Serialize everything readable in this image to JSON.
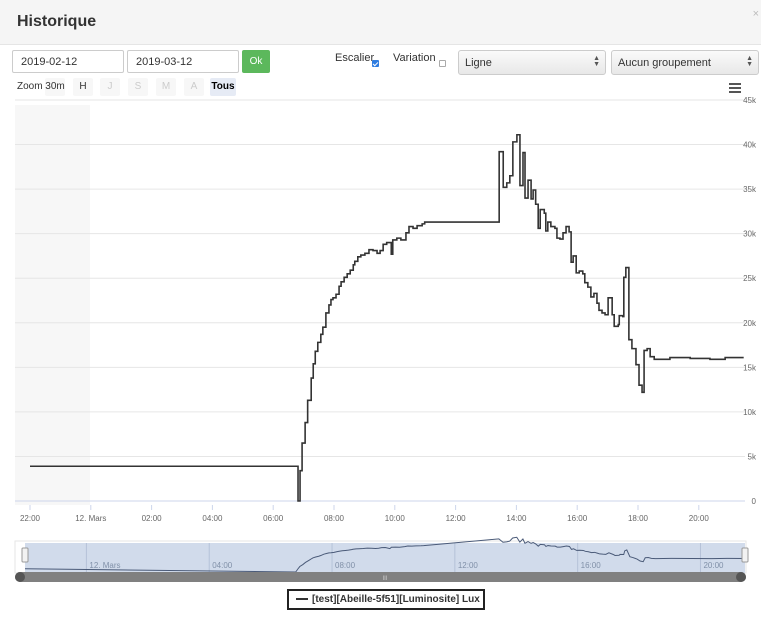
{
  "header": {
    "title": "Historique",
    "close": "×"
  },
  "toolbar": {
    "start_date": "2019-02-12",
    "end_date": "2019-03-12",
    "ok_label": "Ok",
    "escalier_label": "Escalier",
    "escalier_checked": true,
    "variation_label": "Variation",
    "variation_checked": false,
    "chart_type": "Ligne",
    "grouping": "Aucun groupement"
  },
  "zoom": {
    "label": "Zoom",
    "buttons": [
      {
        "label": "30m",
        "state": "normal"
      },
      {
        "label": "H",
        "state": "normal"
      },
      {
        "label": "J",
        "state": "disabled"
      },
      {
        "label": "S",
        "state": "disabled"
      },
      {
        "label": "M",
        "state": "disabled"
      },
      {
        "label": "A",
        "state": "disabled"
      },
      {
        "label": "Tous",
        "state": "active"
      }
    ]
  },
  "navigator": {
    "labels": [
      "12. Mars",
      "04:00",
      "08:00",
      "12:00",
      "16:00",
      "20:00"
    ],
    "handle": "III"
  },
  "legend": {
    "label": "[test][Abeille-5f51][Luminosite] Lux"
  },
  "colors": {
    "line": "#333333",
    "accent": "#5cb85c",
    "navigator": "#c9d5e8"
  },
  "chart_data": {
    "type": "line",
    "step": true,
    "ylim": [
      0,
      45000
    ],
    "yticks": [
      "0",
      "5k",
      "10k",
      "15k",
      "20k",
      "25k",
      "30k",
      "35k",
      "40k",
      "45k"
    ],
    "xticks": [
      "22:00",
      "12. Mars",
      "02:00",
      "04:00",
      "06:00",
      "08:00",
      "10:00",
      "12:00",
      "14:00",
      "16:00",
      "18:00",
      "20:00"
    ],
    "series": [
      {
        "name": "[test][Abeille-5f51][Luminosite] Lux",
        "points": [
          [
            "2019-03-11 22:00",
            3900
          ],
          [
            "2019-03-12 06:49",
            0
          ],
          [
            "2019-03-12 06:53",
            3400
          ],
          [
            "2019-03-12 06:57",
            6500
          ],
          [
            "2019-03-12 07:03",
            8800
          ],
          [
            "2019-03-12 07:08",
            11300
          ],
          [
            "2019-03-12 07:15",
            13800
          ],
          [
            "2019-03-12 07:19",
            15400
          ],
          [
            "2019-03-12 07:23",
            16800
          ],
          [
            "2019-03-12 07:28",
            17800
          ],
          [
            "2019-03-12 07:34",
            18700
          ],
          [
            "2019-03-12 07:38",
            19500
          ],
          [
            "2019-03-12 07:44",
            21100
          ],
          [
            "2019-03-12 07:50",
            22000
          ],
          [
            "2019-03-12 07:54",
            22600
          ],
          [
            "2019-03-12 07:58",
            22800
          ],
          [
            "2019-03-12 08:04",
            23200
          ],
          [
            "2019-03-12 08:10",
            24100
          ],
          [
            "2019-03-12 08:14",
            24600
          ],
          [
            "2019-03-12 08:20",
            25100
          ],
          [
            "2019-03-12 08:26",
            25500
          ],
          [
            "2019-03-12 08:32",
            25900
          ],
          [
            "2019-03-12 08:38",
            26500
          ],
          [
            "2019-03-12 08:41",
            26900
          ],
          [
            "2019-03-12 08:47",
            27400
          ],
          [
            "2019-03-12 08:53",
            27600
          ],
          [
            "2019-03-12 09:01",
            27800
          ],
          [
            "2019-03-12 09:09",
            28200
          ],
          [
            "2019-03-12 09:17",
            28100
          ],
          [
            "2019-03-12 09:25",
            27800
          ],
          [
            "2019-03-12 09:31",
            28100
          ],
          [
            "2019-03-12 09:37",
            28800
          ],
          [
            "2019-03-12 09:44",
            29000
          ],
          [
            "2019-03-12 09:53",
            27700
          ],
          [
            "2019-03-12 09:56",
            29300
          ],
          [
            "2019-03-12 10:04",
            29500
          ],
          [
            "2019-03-12 10:12",
            29300
          ],
          [
            "2019-03-12 10:22",
            30100
          ],
          [
            "2019-03-12 10:28",
            30800
          ],
          [
            "2019-03-12 10:36",
            30600
          ],
          [
            "2019-03-12 10:44",
            30900
          ],
          [
            "2019-03-12 10:54",
            31100
          ],
          [
            "2019-03-12 10:59",
            31300
          ],
          [
            "2019-03-12 13:26",
            39200
          ],
          [
            "2019-03-12 13:34",
            35200
          ],
          [
            "2019-03-12 13:41",
            35700
          ],
          [
            "2019-03-12 13:47",
            36500
          ],
          [
            "2019-03-12 13:53",
            40300
          ],
          [
            "2019-03-12 14:01",
            41100
          ],
          [
            "2019-03-12 14:07",
            35400
          ],
          [
            "2019-03-12 14:13",
            39100
          ],
          [
            "2019-03-12 14:17",
            34000
          ],
          [
            "2019-03-12 14:23",
            36000
          ],
          [
            "2019-03-12 14:29",
            33900
          ],
          [
            "2019-03-12 14:33",
            34900
          ],
          [
            "2019-03-12 14:38",
            33300
          ],
          [
            "2019-03-12 14:43",
            30600
          ],
          [
            "2019-03-12 14:47",
            32700
          ],
          [
            "2019-03-12 14:55",
            32300
          ],
          [
            "2019-03-12 14:58",
            30300
          ],
          [
            "2019-03-12 15:02",
            31300
          ],
          [
            "2019-03-12 15:08",
            30800
          ],
          [
            "2019-03-12 15:16",
            30600
          ],
          [
            "2019-03-12 15:20",
            29500
          ],
          [
            "2019-03-12 15:26",
            29400
          ],
          [
            "2019-03-12 15:32",
            30100
          ],
          [
            "2019-03-12 15:38",
            30800
          ],
          [
            "2019-03-12 15:44",
            30200
          ],
          [
            "2019-03-12 15:48",
            26800
          ],
          [
            "2019-03-12 15:52",
            27500
          ],
          [
            "2019-03-12 15:58",
            25600
          ],
          [
            "2019-03-12 16:04",
            25800
          ],
          [
            "2019-03-12 16:11",
            25500
          ],
          [
            "2019-03-12 16:15",
            24500
          ],
          [
            "2019-03-12 16:21",
            24000
          ],
          [
            "2019-03-12 16:27",
            22900
          ],
          [
            "2019-03-12 16:33",
            23300
          ],
          [
            "2019-03-12 16:39",
            22200
          ],
          [
            "2019-03-12 16:43",
            21400
          ],
          [
            "2019-03-12 16:49",
            21100
          ],
          [
            "2019-03-12 16:55",
            20900
          ],
          [
            "2019-03-12 17:01",
            22800
          ],
          [
            "2019-03-12 17:09",
            20900
          ],
          [
            "2019-03-12 17:13",
            19600
          ],
          [
            "2019-03-12 17:21",
            19800
          ],
          [
            "2019-03-12 17:23",
            20800
          ],
          [
            "2019-03-12 17:30",
            20700
          ],
          [
            "2019-03-12 17:32",
            25100
          ],
          [
            "2019-03-12 17:36",
            26200
          ],
          [
            "2019-03-12 17:42",
            18100
          ],
          [
            "2019-03-12 17:48",
            17100
          ],
          [
            "2019-03-12 17:56",
            15300
          ],
          [
            "2019-03-12 18:02",
            13000
          ],
          [
            "2019-03-12 18:08",
            12200
          ],
          [
            "2019-03-12 18:12",
            16900
          ],
          [
            "2019-03-12 18:18",
            17100
          ],
          [
            "2019-03-12 18:24",
            16200
          ],
          [
            "2019-03-12 18:32",
            15900
          ],
          [
            "2019-03-12 19:03",
            16100
          ],
          [
            "2019-03-12 19:43",
            16000
          ],
          [
            "2019-03-12 20:22",
            15900
          ],
          [
            "2019-03-12 20:52",
            16100
          ],
          [
            "2019-03-12 21:27",
            16000
          ]
        ]
      }
    ]
  }
}
